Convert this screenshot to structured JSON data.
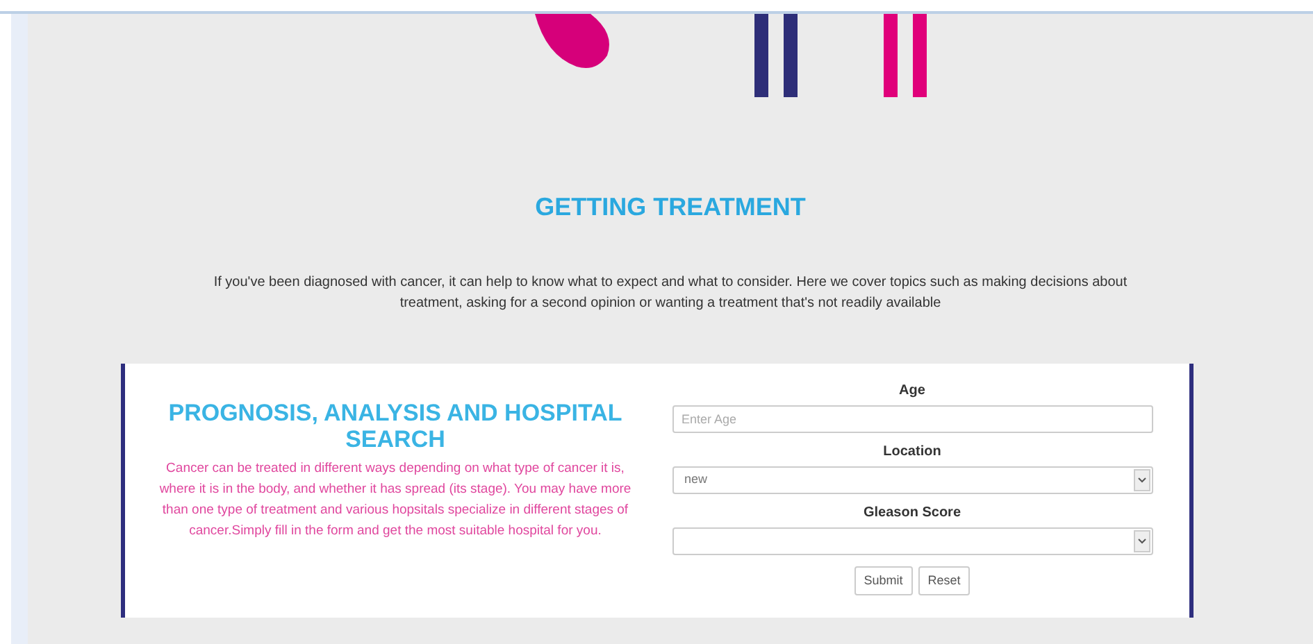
{
  "section": {
    "title": "GETTING TREATMENT",
    "intro": "If you've been diagnosed with cancer, it can help to know what to expect and what to consider. Here we cover topics such as making decisions about treatment, asking for a second opinion or wanting a treatment that's not readily available"
  },
  "card": {
    "title": "PROGNOSIS, ANALYSIS AND HOSPITAL SEARCH",
    "text": "Cancer can be treated in different ways depending on what type of cancer it is, where it is in the body, and whether it has spread (its stage). You may have more than one type of treatment and various hopsitals specialize in different stages of cancer.Simply fill in the form and get the most suitable hospital for you."
  },
  "form": {
    "fields": [
      {
        "kind": "input",
        "label": "Age",
        "placeholder": "Enter Age"
      },
      {
        "kind": "select",
        "label": "Location",
        "value": "new"
      },
      {
        "kind": "select",
        "label": "Gleason Score"
      }
    ],
    "buttons": [
      "Submit",
      "Reset"
    ]
  }
}
